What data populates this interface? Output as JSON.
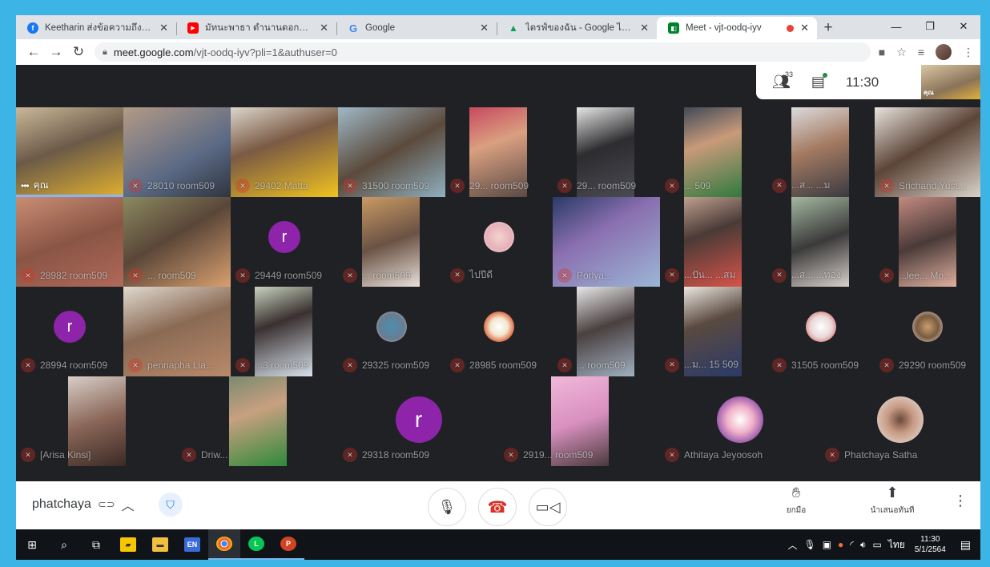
{
  "browser": {
    "tabs": [
      {
        "title": "Keetharin ส่งข้อความถึงคุณ",
        "icon": "facebook-icon",
        "color": "#1877f2",
        "glyph": "f"
      },
      {
        "title": "มัทนะพาธา ตำนานดอกกุหลาบ | Po",
        "icon": "youtube-icon",
        "color": "#ff0000",
        "glyph": "▶"
      },
      {
        "title": "Google",
        "icon": "google-icon",
        "color": "#4285f4",
        "glyph": "G"
      },
      {
        "title": "ไดรฟ์ของฉัน - Google ไดรฟ์",
        "icon": "drive-icon",
        "color": "#0f9d58",
        "glyph": "▲"
      },
      {
        "title": "Meet - vjt-oodq-iyv",
        "icon": "meet-icon",
        "color": "#00832d",
        "glyph": "◧"
      }
    ],
    "url_host": "meet.google.com",
    "url_path": "/vjt-oodq-iyv?pli=1&authuser=0"
  },
  "meet": {
    "participants_count": "33",
    "time": "11:30",
    "self_label": "คุณ",
    "tiles": [
      {
        "name": "คุณ",
        "type": "video",
        "bg": "linear-gradient(160deg,#cbb89a 0%,#6b5a48 45%,#e0b02e 100%)"
      },
      {
        "name": "28010 room509",
        "type": "video",
        "bg": "linear-gradient(150deg,#b39a86 0%,#5b6a85 60%,#2f3440 100%)"
      },
      {
        "name": "29402 Matta",
        "type": "video",
        "bg": "linear-gradient(160deg,#dcd6cc 0%,#7a5a44 40%,#f0c21f 100%)"
      },
      {
        "name": "31500 room509",
        "type": "video",
        "bg": "linear-gradient(150deg,#9fb9c6 0%,#5b4a3c 50%,#8fb0c0 100%)"
      },
      {
        "name": "29... room509",
        "type": "video",
        "bg": "linear-gradient(160deg,#c94960 0%,#d9a080 40%,#5a4a44 100%)"
      },
      {
        "name": "29... room509",
        "type": "video",
        "bg": "linear-gradient(160deg,#e6e6e6 0%,#2d2d30 45%,#4a4a52 100%)"
      },
      {
        "name": "... 509",
        "type": "video",
        "bg": "linear-gradient(160deg,#3f4a58 0%,#c99a7a 40%,#2f7a3f 100%)"
      },
      {
        "name": "...ส... ...ม",
        "type": "video",
        "bg": "linear-gradient(160deg,#dcdcdc 0%,#a47a62 45%,#3a3a40 100%)"
      },
      {
        "name": "Srichand Yust...",
        "type": "video",
        "bg": "linear-gradient(150deg,#e8e4de 0%,#5c4438 45%,#d9d2c8 100%)"
      },
      {
        "name": "28982 room509",
        "type": "video",
        "bg": "linear-gradient(160deg,#c98d74 0%,#8a5544 50%,#b0695a 100%)"
      },
      {
        "name": "... room509",
        "type": "video",
        "bg": "linear-gradient(150deg,#8a8a60 0%,#5a4638 45%,#d8a070 100%)"
      },
      {
        "name": "29449 room509",
        "type": "letter",
        "letter": "r",
        "bg": "#202124"
      },
      {
        "name": "... room509",
        "type": "video",
        "bg": "linear-gradient(160deg,#c99a64 0%,#6a5244 50%,#e8e0da 100%)"
      },
      {
        "name": "ไปปีดี",
        "type": "pic",
        "bg": "#202124",
        "pic": "radial-gradient(circle,#f4d4d0 0%,#e6b0b8 60%,#ffffff 100%)"
      },
      {
        "name": "Porlya...",
        "type": "video",
        "bg": "linear-gradient(150deg,#2a3a66 0%,#8a6fb0 40%,#9bb6d4 100%)"
      },
      {
        "name": "...ปัน... ...สม",
        "type": "video",
        "bg": "linear-gradient(160deg,#bfa090 0%,#4a3a36 40%,#d6544a 100%)"
      },
      {
        "name": "...ส... ...ทอง",
        "type": "video",
        "bg": "linear-gradient(160deg,#a4b8a0 0%,#3b3a3a 50%,#d8d0cc 100%)"
      },
      {
        "name": "...lee... Mo...",
        "type": "video",
        "bg": "linear-gradient(160deg,#c28a80 0%,#4a3a38 50%,#e0b0a0 100%)"
      },
      {
        "name": "28994 room509",
        "type": "letter",
        "letter": "r",
        "bg": "#202124"
      },
      {
        "name": "pennapha Lia...",
        "type": "video",
        "bg": "linear-gradient(160deg,#e0dad0 0%,#8a6a54 45%,#b98a6a 100%)"
      },
      {
        "name": "...3 room509",
        "type": "video",
        "bg": "linear-gradient(160deg,#c8d4c0 0%,#3a3030 40%,#d8e2ec 100%)"
      },
      {
        "name": "29325 room509",
        "type": "pic",
        "bg": "#202124",
        "pic": "radial-gradient(circle,#4a90b0 0%,#6a7c90 60%,#d0d8e0 100%)"
      },
      {
        "name": "28985 room509",
        "type": "pic",
        "bg": "#202124",
        "pic": "radial-gradient(circle,#ffffff 0%,#f2e8d0 40%,#e0704a 70%,#3a8a3a 100%)"
      },
      {
        "name": "... room509",
        "type": "video",
        "bg": "linear-gradient(160deg,#e8e8e8 0%,#4a4040 45%,#a0b0c0 100%)"
      },
      {
        "name": "...ม... 15 509",
        "type": "video",
        "bg": "linear-gradient(160deg,#ece8e0 0%,#5a4a40 40%,#2a3a6a 100%)"
      },
      {
        "name": "31505 room509",
        "type": "pic",
        "bg": "#202124",
        "pic": "radial-gradient(circle,#ffffff 0%,#e8d8d8 50%,#d04040 100%)"
      },
      {
        "name": "29290 room509",
        "type": "pic",
        "bg": "#202124",
        "pic": "radial-gradient(circle,#c8a070 0%,#7a5a40 50%,#e8e0d8 100%)"
      },
      {
        "name": "[Arisa Kinsi]",
        "type": "video",
        "bg": "linear-gradient(160deg,#d8cfc8 0%,#8a6658 50%,#3a2a24 100%)"
      },
      {
        "name": "Driw...",
        "type": "video",
        "bg": "linear-gradient(160deg,#7a8a70 0%,#c8a080 40%,#2e8a3a 100%)"
      },
      {
        "name": "29318 room509",
        "type": "letter-big",
        "letter": "r",
        "bg": "#202124"
      },
      {
        "name": "2919... room509",
        "type": "video",
        "bg": "linear-gradient(160deg,#f0b8d8 0%,#d890c0 50%,#4a3a3a 100%)"
      },
      {
        "name": "Athitaya Jeyoosoh",
        "type": "pic-big",
        "bg": "#202124",
        "pic": "radial-gradient(circle,#ffffff 0%,#f0b0c8 40%,#a060b0 70%,#e8e8f0 100%)"
      },
      {
        "name": "Phatchaya Satha",
        "type": "pic-big",
        "bg": "#202124",
        "pic": "radial-gradient(circle,#6a4a38 0%,#c89a84 40%,#e8e4e0 100%)"
      }
    ]
  },
  "controls": {
    "meeting_owner": "phatchaya",
    "raise_hand_label": "ยกมือ",
    "present_label": "นำเสนอทันที"
  },
  "taskbar": {
    "time": "11:30",
    "date": "5/1/2564",
    "lang": "ไทย"
  }
}
